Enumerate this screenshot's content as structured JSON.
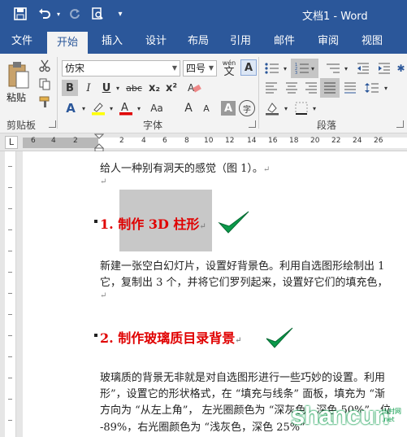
{
  "window": {
    "title": "文档1 - Word"
  },
  "tabs": [
    {
      "label": "文件"
    },
    {
      "label": "开始"
    },
    {
      "label": "插入"
    },
    {
      "label": "设计"
    },
    {
      "label": "布局"
    },
    {
      "label": "引用"
    },
    {
      "label": "邮件"
    },
    {
      "label": "审阅"
    },
    {
      "label": "视图"
    }
  ],
  "active_tab": "开始",
  "ribbon": {
    "clipboard": {
      "group_label": "剪贴板",
      "paste_label": "粘贴"
    },
    "font": {
      "group_label": "字体",
      "font_name": "仿宋",
      "font_size": "四号",
      "phonetic_label": "wén",
      "phonetic_char": "文",
      "bold": "B",
      "italic": "I",
      "underline": "U",
      "strike": "abc",
      "subscript": "x₂",
      "superscript": "x²",
      "char_border": "A",
      "enlarge": "A",
      "shrink": "A",
      "aa": "Aa",
      "shade": "A",
      "enclose": "字"
    },
    "paragraph": {
      "group_label": "段落"
    }
  },
  "ruler": {
    "numbers": [
      "6",
      "4",
      "2",
      "",
      "2",
      "4",
      "6",
      "8",
      "10",
      "12",
      "14",
      "16",
      "18",
      "20",
      "22",
      "24",
      "26"
    ],
    "corner": "L"
  },
  "document": {
    "line1": "给人一种别有洞天的感觉（图 1）。",
    "heading1": "1. 制作 3D 柱形",
    "para1_line1": "新建一张空白幻灯片，设置好背景色。利用自选图形绘制出 1",
    "para1_line2": "它，复制出 3 个，并将它们罗列起来，设置好它们的填充色，",
    "heading2": "2. 制作玻璃质目录背景",
    "para2_line1": "玻璃质的背景无非就是对自选图形进行一些巧妙的设置。利用",
    "para2_line2": "形”，设置它的形状格式，在 “填充与线条” 面板，填充为 “渐",
    "para2_line3": "方向为 “从左上角”， 左光圈颜色为 “深灰色，深色 50%”，位",
    "para2_line4": "-89%，右光圈颜色为 “浅灰色，深色 25%”",
    "para_mark": "↵"
  },
  "watermark": {
    "text_main": "shancun",
    "text_sub": ".net",
    "text_cn": "山村网"
  },
  "colors": {
    "brand": "#2b579a",
    "heading": "#e00000",
    "check": "#0a9a4a"
  }
}
